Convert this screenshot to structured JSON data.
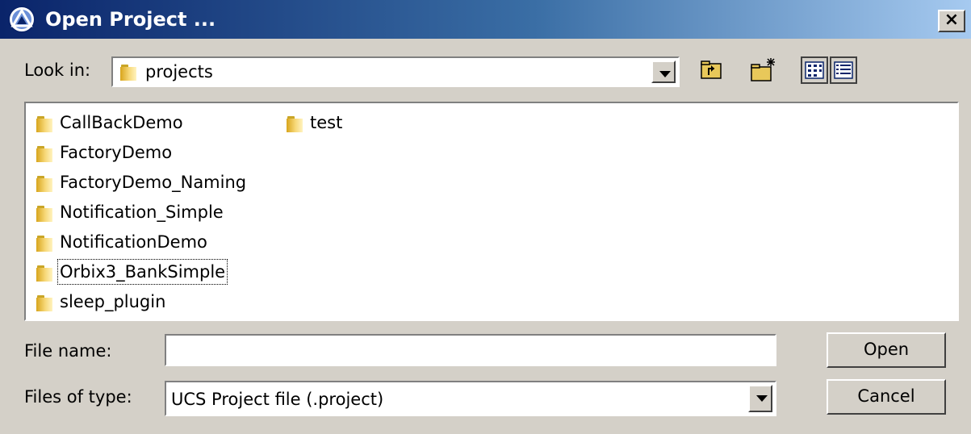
{
  "window": {
    "title": "Open Project ...",
    "close_label": "×"
  },
  "lookin": {
    "label": "Look in:",
    "value": "projects"
  },
  "toolbar": {
    "up_icon": "folder-up-icon",
    "new_folder_icon": "new-folder-icon",
    "list_view_icon": "list-view-icon",
    "details_view_icon": "details-view-icon"
  },
  "files": [
    {
      "name": "CallBackDemo"
    },
    {
      "name": "FactoryDemo"
    },
    {
      "name": "FactoryDemo_Naming"
    },
    {
      "name": "Notification_Simple"
    },
    {
      "name": "NotificationDemo"
    },
    {
      "name": "Orbix3_BankSimple"
    },
    {
      "name": "sleep_plugin"
    },
    {
      "name": "test"
    }
  ],
  "filename": {
    "label": "File name:",
    "value": ""
  },
  "filetype": {
    "label": "Files of type:",
    "value": "UCS Project file (.project)"
  },
  "buttons": {
    "open": "Open",
    "cancel": "Cancel"
  },
  "colors": {
    "title_start": "#0a246a",
    "title_end": "#a6caf0",
    "face": "#d4d0c8",
    "folder": "#f7d878"
  }
}
